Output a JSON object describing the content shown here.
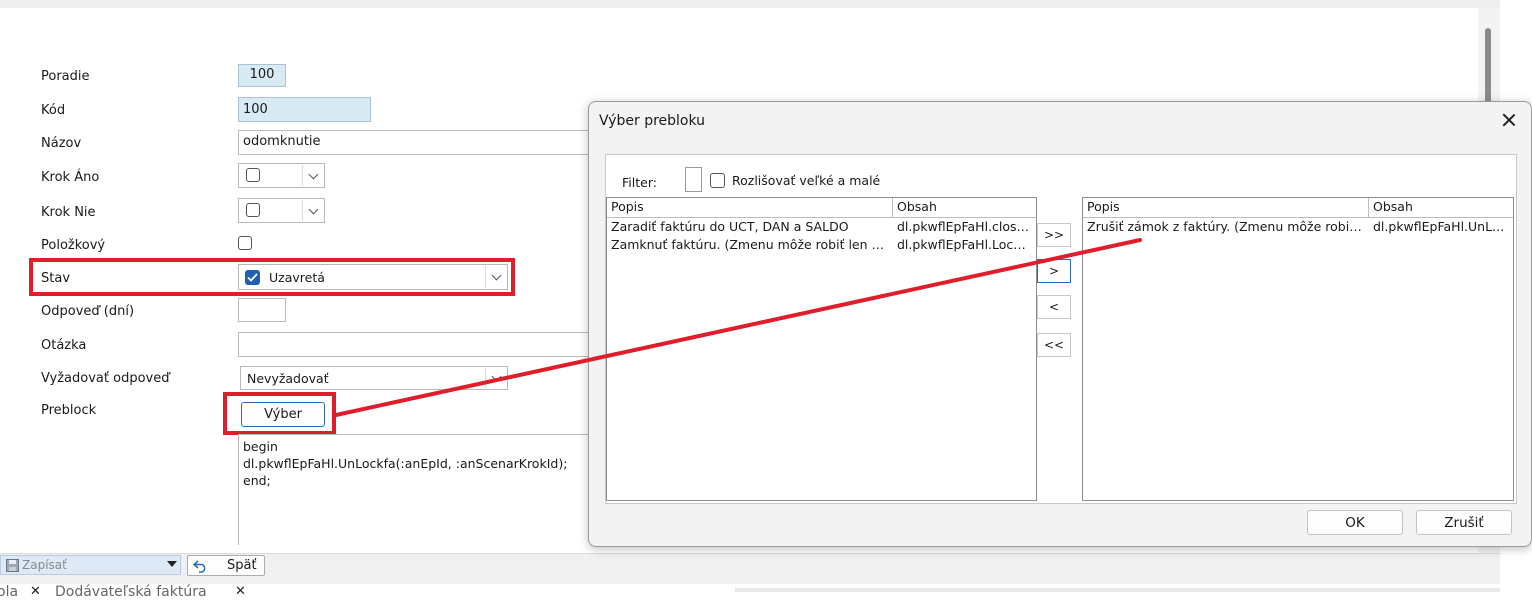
{
  "form": {
    "poradie": {
      "label": "Poradie",
      "value": "100"
    },
    "kod": {
      "label": "Kód",
      "value": "100"
    },
    "nazov": {
      "label": "Názov",
      "value": "odomknutie"
    },
    "krok_ano": {
      "label": "Krok Áno"
    },
    "krok_nie": {
      "label": "Krok Nie"
    },
    "polozkovy": {
      "label": "Položkový"
    },
    "stav": {
      "label": "Stav",
      "value": "Uzavretá",
      "checked": true
    },
    "odpoved": {
      "label": "Odpoveď (dní)",
      "value": ""
    },
    "otazka": {
      "label": "Otázka",
      "value": ""
    },
    "vyzadovat": {
      "label": "Vyžadovať odpoveď",
      "value": "Nevyžadovať"
    },
    "preblock": {
      "label": "Preblock",
      "button_label": "Výber",
      "code_lines": [
        "begin",
        "dl.pkwflEpFaHl.UnLockfa(:anEpId, :anScenarKrokId);",
        "end;"
      ]
    }
  },
  "toolbar": {
    "save_label": "Zapísať",
    "back_label": "Späť"
  },
  "tabs": [
    {
      "label": "ola"
    },
    {
      "label": "Dodávateľská faktúra"
    }
  ],
  "dialog": {
    "title": "Výber prebloku",
    "filter_label": "Filter:",
    "filter_value": "",
    "case_sensitive_label": "Rozlišovať veľké a malé",
    "left_grid": {
      "columns": [
        "Popis",
        "Obsah"
      ],
      "rows": [
        {
          "popis": "Zaradiť faktúru do UCT, DAN a SALDO",
          "obsah": "dl.pkwflEpFaHl.closef…"
        },
        {
          "popis": "Zamknuť faktúru. (Zmenu môže robiť len opra…",
          "obsah": "dl.pkwflEpFaHl.Lockf…"
        }
      ]
    },
    "right_grid": {
      "columns": [
        "Popis",
        "Obsah"
      ],
      "rows": [
        {
          "popis": "Zrušiť zámok z faktúry. (Zmenu môže robiť ho…",
          "obsah": "dl.pkwflEpFaHl.UnLo…"
        }
      ]
    },
    "move_buttons": [
      ">>",
      ">",
      "<",
      "<<"
    ],
    "ok_label": "OK",
    "cancel_label": "Zrušiť"
  },
  "colors": {
    "annotation": "#e01e2b",
    "readonly_field": "#d8ebf5",
    "checkbox_checked": "#1f5fb4"
  }
}
